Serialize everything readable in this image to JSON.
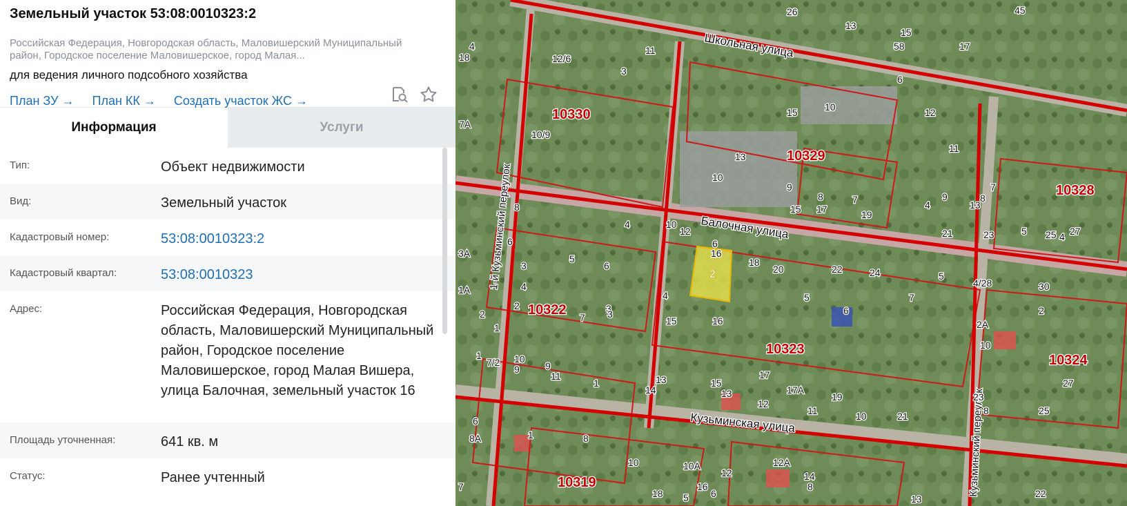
{
  "title": "Земельный участок 53:08:0010323:2",
  "subaddress": "Российская Федерация, Новгородская область, Маловишерский Муниципальный район, Городское поселение Маловишерское, город Малая...",
  "purpose": "для ведения личного подсобного хозяйства",
  "links": {
    "plan_zu": "План ЗУ",
    "plan_kk": "План КК",
    "create_zhs": "Создать участок ЖС",
    "arrow": "→"
  },
  "tabs": {
    "info": "Информация",
    "services": "Услуги"
  },
  "rows": {
    "type": {
      "label": "Тип:",
      "value": "Объект недвижимости"
    },
    "kind": {
      "label": "Вид:",
      "value": "Земельный участок"
    },
    "cad_num": {
      "label": "Кадастровый номер:",
      "value": "53:08:0010323:2"
    },
    "cad_quarter": {
      "label": "Кадастровый квартал:",
      "value": "53:08:0010323"
    },
    "address": {
      "label": "Адрес:",
      "value": "Российская Федерация, Новгородская область, Маловишерский Муниципальный район, Городское поселение Маловишерское, город Малая Вишера, улица Балочная, земельный участок 16"
    },
    "area": {
      "label": "Площадь уточненная:",
      "value": "641 кв. м"
    },
    "status": {
      "label": "Статус:",
      "value": "Ранее учтенный"
    }
  },
  "map": {
    "streets": {
      "shkolnaya": "Школьная улица",
      "balochnaya": "Балочная улица",
      "kuzminskaya": "Кузьминская улица",
      "kuzminsky_per1": "1-й Кузьминский переулок",
      "kuzminsky_per": "Кузьминский переулок"
    },
    "quarters": [
      "10330",
      "10329",
      "10328",
      "10322",
      "10323",
      "10324",
      "10319"
    ],
    "selected_parcel": "2",
    "labels": [
      {
        "t": "11"
      },
      {
        "t": "13"
      },
      {
        "t": "15"
      },
      {
        "t": "17"
      },
      {
        "t": "45"
      },
      {
        "t": "4"
      },
      {
        "t": "18"
      },
      {
        "t": "12/6"
      },
      {
        "t": "11"
      },
      {
        "t": "3"
      },
      {
        "t": "58"
      },
      {
        "t": "10/9"
      },
      {
        "t": "15"
      },
      {
        "t": "10"
      },
      {
        "t": "12"
      },
      {
        "t": "11"
      },
      {
        "t": "7А"
      },
      {
        "t": "13"
      },
      {
        "t": "10"
      },
      {
        "t": "9"
      },
      {
        "t": "8"
      },
      {
        "t": "7"
      },
      {
        "t": "15"
      },
      {
        "t": "17"
      },
      {
        "t": "19"
      },
      {
        "t": "9"
      },
      {
        "t": "4"
      },
      {
        "t": "8"
      },
      {
        "t": "7"
      },
      {
        "t": "13"
      },
      {
        "t": "6"
      },
      {
        "t": "8"
      },
      {
        "t": "4"
      },
      {
        "t": "10"
      },
      {
        "t": "12"
      },
      {
        "t": "6"
      },
      {
        "t": "16"
      },
      {
        "t": "18"
      },
      {
        "t": "20"
      },
      {
        "t": "22"
      },
      {
        "t": "24"
      },
      {
        "t": "5"
      },
      {
        "t": "4/28"
      },
      {
        "t": "30"
      },
      {
        "t": "21"
      },
      {
        "t": "23"
      },
      {
        "t": "5"
      },
      {
        "t": "25"
      },
      {
        "t": "4"
      },
      {
        "t": "27"
      },
      {
        "t": "3А"
      },
      {
        "t": "6"
      },
      {
        "t": "5"
      },
      {
        "t": "6"
      },
      {
        "t": "3"
      },
      {
        "t": "3"
      },
      {
        "t": "1А"
      },
      {
        "t": "4"
      },
      {
        "t": "4"
      },
      {
        "t": "5"
      },
      {
        "t": "7"
      },
      {
        "t": "6"
      },
      {
        "t": "1"
      },
      {
        "t": "2"
      },
      {
        "t": "2"
      },
      {
        "t": "2"
      },
      {
        "t": "7"
      },
      {
        "t": "3"
      },
      {
        "t": "15"
      },
      {
        "t": "16"
      },
      {
        "t": "2А"
      },
      {
        "t": "10"
      },
      {
        "t": "1"
      },
      {
        "t": "7/2"
      },
      {
        "t": "10"
      },
      {
        "t": "9"
      },
      {
        "t": "9"
      },
      {
        "t": "11"
      },
      {
        "t": "1"
      },
      {
        "t": "13"
      },
      {
        "t": "14"
      },
      {
        "t": "15"
      },
      {
        "t": "13"
      },
      {
        "t": "17"
      },
      {
        "t": "12"
      },
      {
        "t": "17А"
      },
      {
        "t": "11"
      },
      {
        "t": "19"
      },
      {
        "t": "10"
      },
      {
        "t": "21"
      },
      {
        "t": "23"
      },
      {
        "t": "8"
      },
      {
        "t": "25"
      },
      {
        "t": "27"
      },
      {
        "t": "6"
      },
      {
        "t": "8А"
      },
      {
        "t": "1"
      },
      {
        "t": "8"
      },
      {
        "t": "10"
      },
      {
        "t": "10А"
      },
      {
        "t": "12"
      },
      {
        "t": "12А"
      },
      {
        "t": "14"
      },
      {
        "t": "16"
      },
      {
        "t": "6"
      },
      {
        "t": "8"
      },
      {
        "t": "18"
      },
      {
        "t": "5"
      },
      {
        "t": "7"
      },
      {
        "t": "13"
      },
      {
        "t": "22"
      },
      {
        "t": "26"
      }
    ]
  }
}
